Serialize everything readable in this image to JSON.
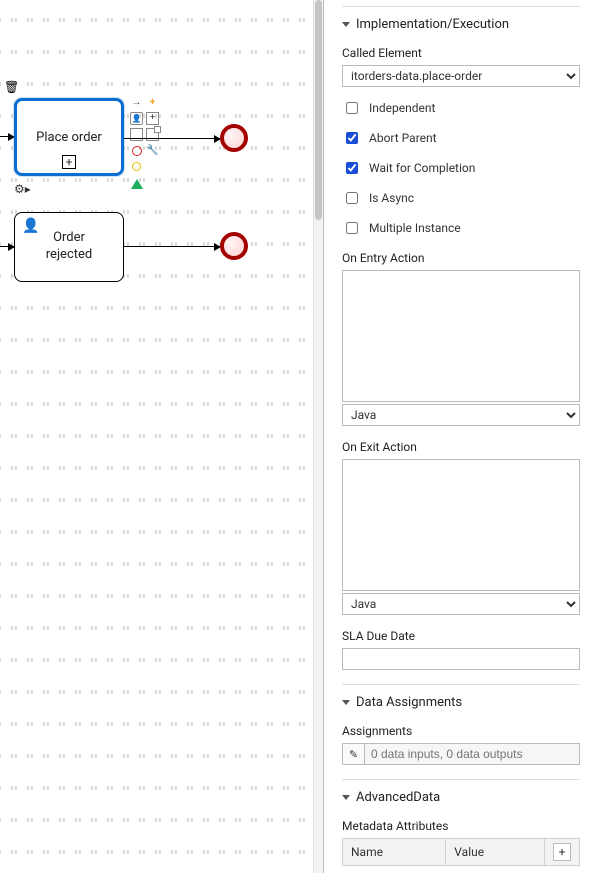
{
  "canvas": {
    "selected_node_label": "Place order",
    "rejected_node_label": "Order\nrejected"
  },
  "panel": {
    "section1_title": "Implementation/Execution",
    "called_element_label": "Called Element",
    "called_element_value": "itorders-data.place-order",
    "chk_independent": "Independent",
    "chk_abort": "Abort Parent",
    "chk_wait": "Wait for Completion",
    "chk_async": "Is Async",
    "chk_multi": "Multiple Instance",
    "on_entry_label": "On Entry Action",
    "on_exit_label": "On Exit Action",
    "lang_options": [
      "Java"
    ],
    "lang_value": "Java",
    "sla_label": "SLA Due Date",
    "sla_value": "",
    "section2_title": "Data Assignments",
    "assignments_label": "Assignments",
    "assignments_placeholder": "0 data inputs, 0 data outputs",
    "section3_title": "AdvancedData",
    "meta_label": "Metadata Attributes",
    "meta_col_name": "Name",
    "meta_col_value": "Value"
  }
}
